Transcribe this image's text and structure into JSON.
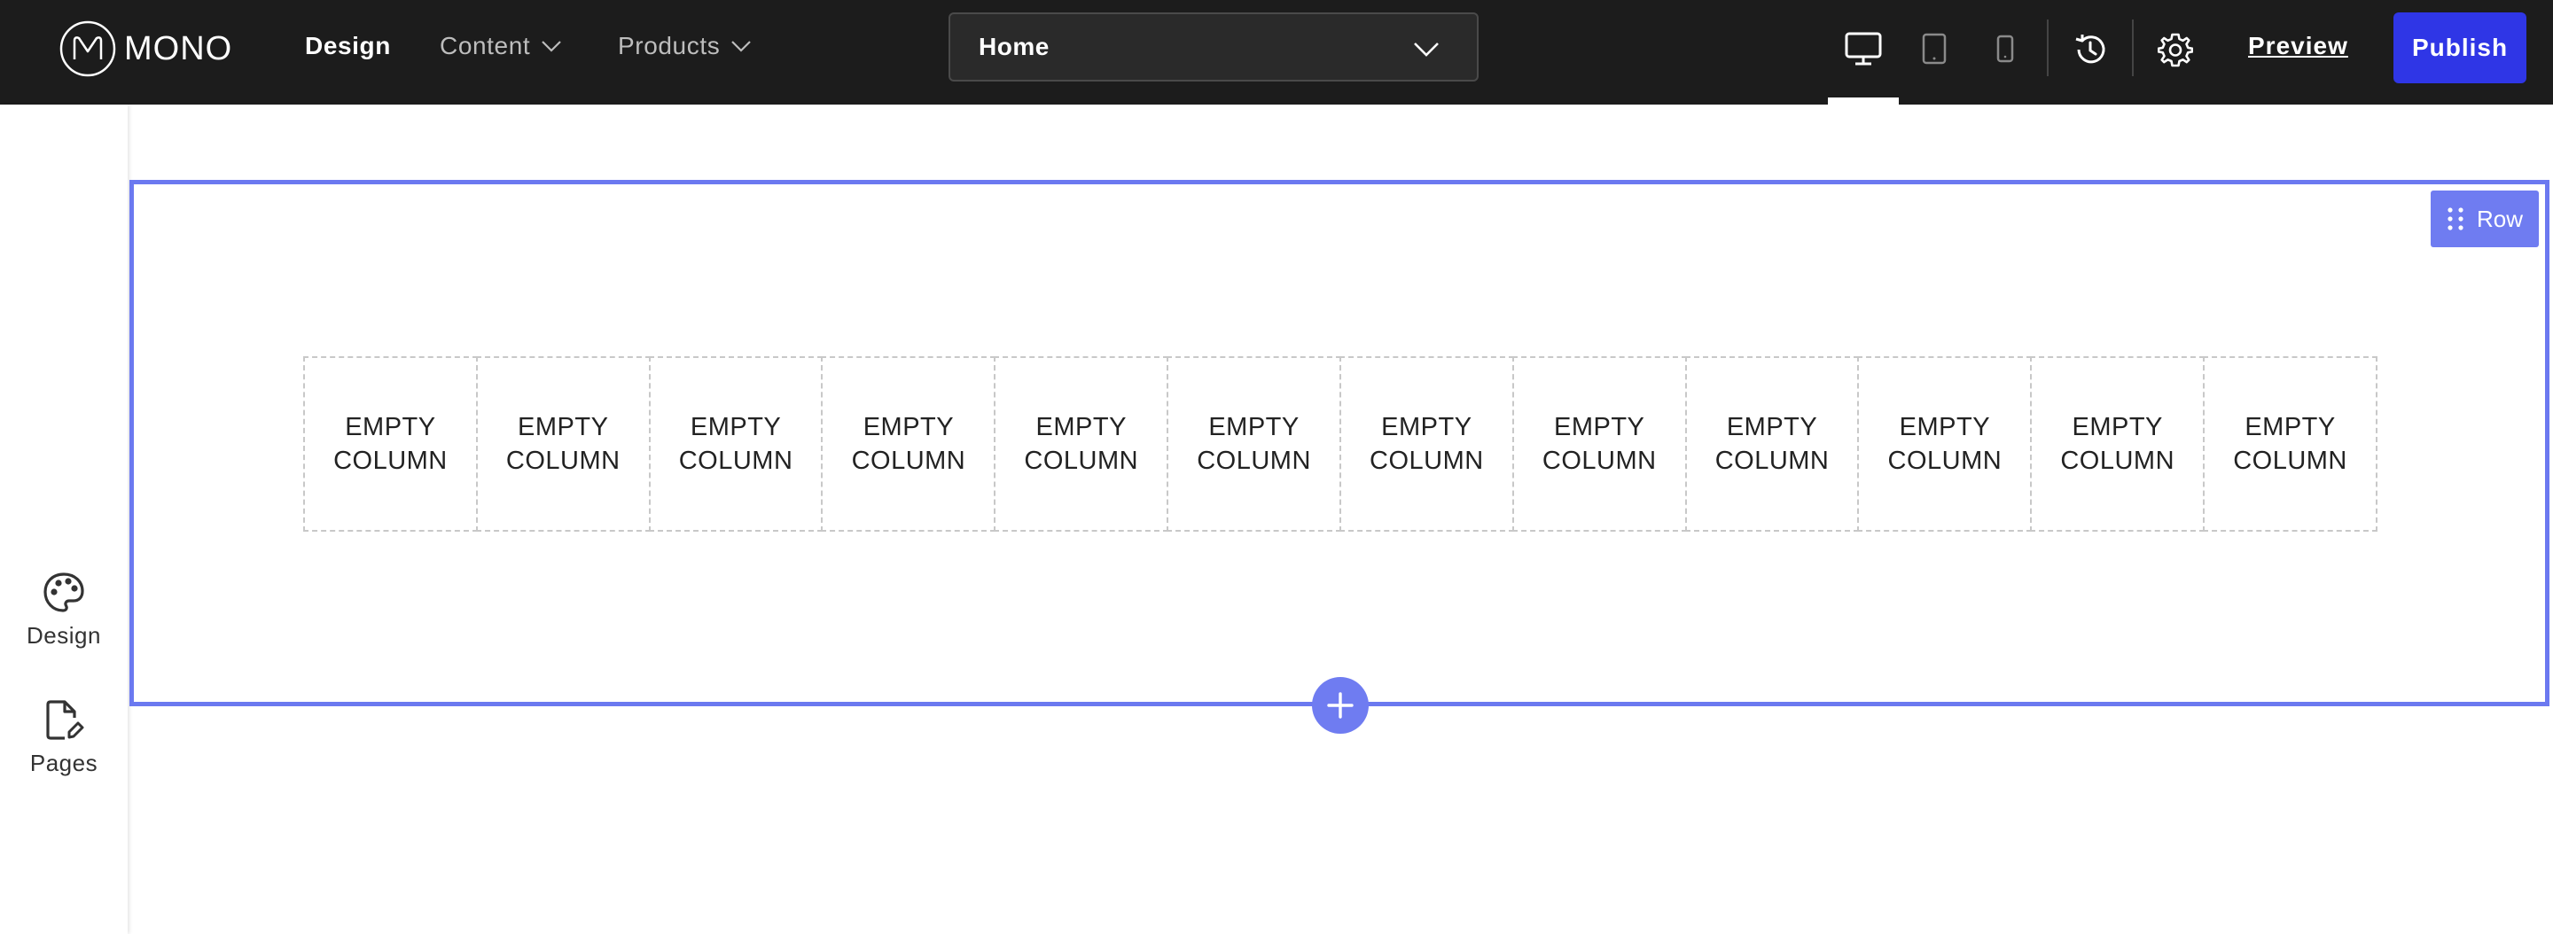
{
  "brand": {
    "logo_text": "MONO"
  },
  "topnav": {
    "design_label": "Design",
    "content_label": "Content",
    "products_label": "Products"
  },
  "page_selector": {
    "selected": "Home"
  },
  "device_toggle": {
    "active": "desktop"
  },
  "actions": {
    "preview_label": "Preview",
    "publish_label": "Publish",
    "publish_color": "#2f36e6"
  },
  "sidebar": {
    "items": [
      {
        "label": "Design",
        "icon": "palette-icon"
      },
      {
        "label": "Pages",
        "icon": "page-edit-icon"
      }
    ]
  },
  "canvas": {
    "row_label": "Row",
    "accent_color": "#6b79f0",
    "columns": [
      {
        "line1": "EMPTY",
        "line2": "COLUMN"
      },
      {
        "line1": "EMPTY",
        "line2": "COLUMN"
      },
      {
        "line1": "EMPTY",
        "line2": "COLUMN"
      },
      {
        "line1": "EMPTY",
        "line2": "COLUMN"
      },
      {
        "line1": "EMPTY",
        "line2": "COLUMN"
      },
      {
        "line1": "EMPTY",
        "line2": "COLUMN"
      },
      {
        "line1": "EMPTY",
        "line2": "COLUMN"
      },
      {
        "line1": "EMPTY",
        "line2": "COLUMN"
      },
      {
        "line1": "EMPTY",
        "line2": "COLUMN"
      },
      {
        "line1": "EMPTY",
        "line2": "COLUMN"
      },
      {
        "line1": "EMPTY",
        "line2": "COLUMN"
      },
      {
        "line1": "EMPTY",
        "line2": "COLUMN"
      }
    ]
  }
}
